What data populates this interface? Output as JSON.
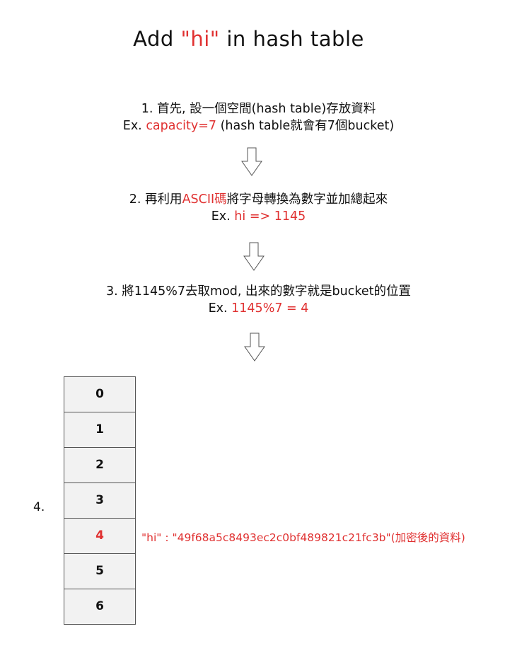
{
  "title": {
    "prefix": "Add ",
    "highlight": "\"hi\"",
    "suffix": " in hash table"
  },
  "steps": [
    {
      "line1": "1. 首先, 設一個空間(hash table)存放資料",
      "line2": {
        "prefix": "Ex. ",
        "highlight": "capacity=7",
        "suffix": " (hash table就會有7個bucket)"
      }
    },
    {
      "line1": {
        "prefix": "2. 再利用",
        "highlight": "ASCII碼",
        "suffix": "將字母轉換為數字並加總起來"
      },
      "line2": {
        "prefix": "Ex. ",
        "highlight": "hi => 1145"
      }
    },
    {
      "line1": "3. 將1145%7去取mod, 出來的數字就是bucket的位置",
      "line2": {
        "prefix": "Ex. ",
        "highlight": "1145%7 = 4"
      }
    }
  ],
  "step4_label": "4.",
  "buckets": [
    "0",
    "1",
    "2",
    "3",
    "4",
    "5",
    "6"
  ],
  "highlight_bucket": "4",
  "stored_entry": "\"hi\" : \"49f68a5c8493ec2c0bf489821c21fc3b\"(加密後的資料)",
  "colors": {
    "accent": "#e03131",
    "cell_fill": "#f2f2f2",
    "border": "#555555"
  },
  "icons": {
    "arrow": "down-arrow-icon"
  }
}
